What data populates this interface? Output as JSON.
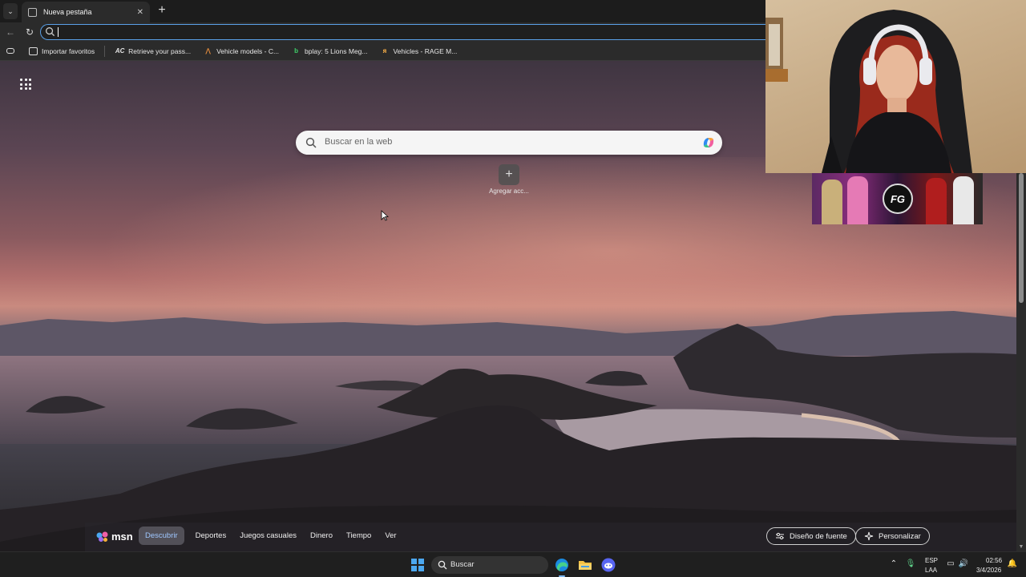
{
  "browser": {
    "tab_title": "Nueva pestaña",
    "new_tab_icon": "plus-icon",
    "tab_list_icon": "chevron-down-icon",
    "address_value": "",
    "favorites": [
      {
        "label": "Importar favoritos",
        "icon": "folder-import-icon"
      },
      {
        "label": "Retrieve your pass...",
        "icon": "ac-icon"
      },
      {
        "label": "Vehicle models - C...",
        "icon": "vehicle-icon"
      },
      {
        "label": "bplay: 5 Lions Meg...",
        "icon": "bplay-icon"
      },
      {
        "label": "Vehicles - RAGE M...",
        "icon": "rage-icon"
      }
    ]
  },
  "ntp": {
    "search_placeholder": "Buscar en la web",
    "add_shortcut_label": "Agregar acc...",
    "msn": {
      "logo": "msn",
      "nav": [
        "Descubrir",
        "Deportes",
        "Juegos casuales",
        "Dinero",
        "Tiempo",
        "Ver"
      ],
      "active": "Descubrir",
      "font_design": "Diseño de fuente",
      "personalize": "Personalizar"
    }
  },
  "overlay": {
    "banner_logo": "FG"
  },
  "taskbar": {
    "search_label": "Buscar",
    "lang_top": "ESP",
    "lang_bottom": "LAA",
    "time": "02:56",
    "date": "3/4/2026"
  },
  "colors": {
    "accent": "#5aa0e8",
    "msn_active": "#9fc7ff",
    "windows_blue": "#4ca8f0"
  }
}
